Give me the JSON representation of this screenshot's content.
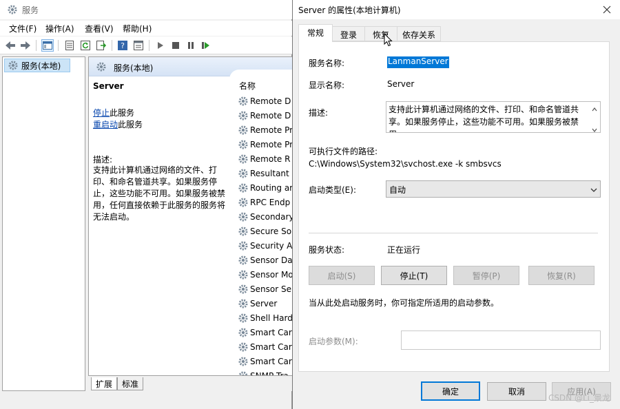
{
  "services_window": {
    "title": "服务",
    "menu": [
      "文件(F)",
      "操作(A)",
      "查看(V)",
      "帮助(H)"
    ],
    "tree_root": "服务(本地)",
    "detail_header": "服务(本地)",
    "selected_service": "Server",
    "stop_link": "停止",
    "stop_suffix": "此服务",
    "restart_link": "重启动",
    "restart_suffix": "此服务",
    "description_label": "描述:",
    "description": "支持此计算机通过网络的文件、打印、和命名管道共享。如果服务停止，这些功能不可用。如果服务被禁用，任何直接依赖于此服务的服务将无法启动。",
    "column_name": "名称",
    "rows": [
      "Remote D",
      "Remote D",
      "Remote Pr",
      "Remote Pr",
      "Remote R",
      "Resultant",
      "Routing ar",
      "RPC Endp",
      "Secondary",
      "Secure So",
      "Security A",
      "Sensor Da",
      "Sensor Mo",
      "Sensor Se",
      "Server",
      "Shell Hard",
      "Smart Car",
      "Smart Car",
      "Smart Car",
      "SNMP Tra"
    ],
    "bottom_tabs": [
      "扩展",
      "标准"
    ]
  },
  "dialog": {
    "title": "Server 的属性(本地计算机)",
    "tabs": [
      "常规",
      "登录",
      "恢复",
      "依存关系"
    ],
    "service_name_label": "服务名称:",
    "service_name": "LanmanServer",
    "display_name_label": "显示名称:",
    "display_name": "Server",
    "description_label": "描述:",
    "description": "支持此计算机通过网络的文件、打印、和命名管道共享。如果服务停止，这些功能不可用。如果服务被禁用，",
    "path_label": "可执行文件的路径:",
    "path": "C:\\Windows\\System32\\svchost.exe -k smbsvcs",
    "startup_type_label": "启动类型(E):",
    "startup_type": "自动",
    "status_label": "服务状态:",
    "status": "正在运行",
    "buttons": {
      "start": "启动(S)",
      "stop": "停止(T)",
      "pause": "暂停(P)",
      "resume": "恢复(R)"
    },
    "hint": "当从此处启动服务时，你可指定所适用的启动参数。",
    "params_label": "启动参数(M):",
    "ok": "确定",
    "cancel": "取消",
    "apply": "应用(A)"
  },
  "watermark": "CSDN @Li_景龙",
  "colors": {
    "accent": "#0078d7",
    "link": "#0645ad",
    "selection": "#cce4f7"
  }
}
